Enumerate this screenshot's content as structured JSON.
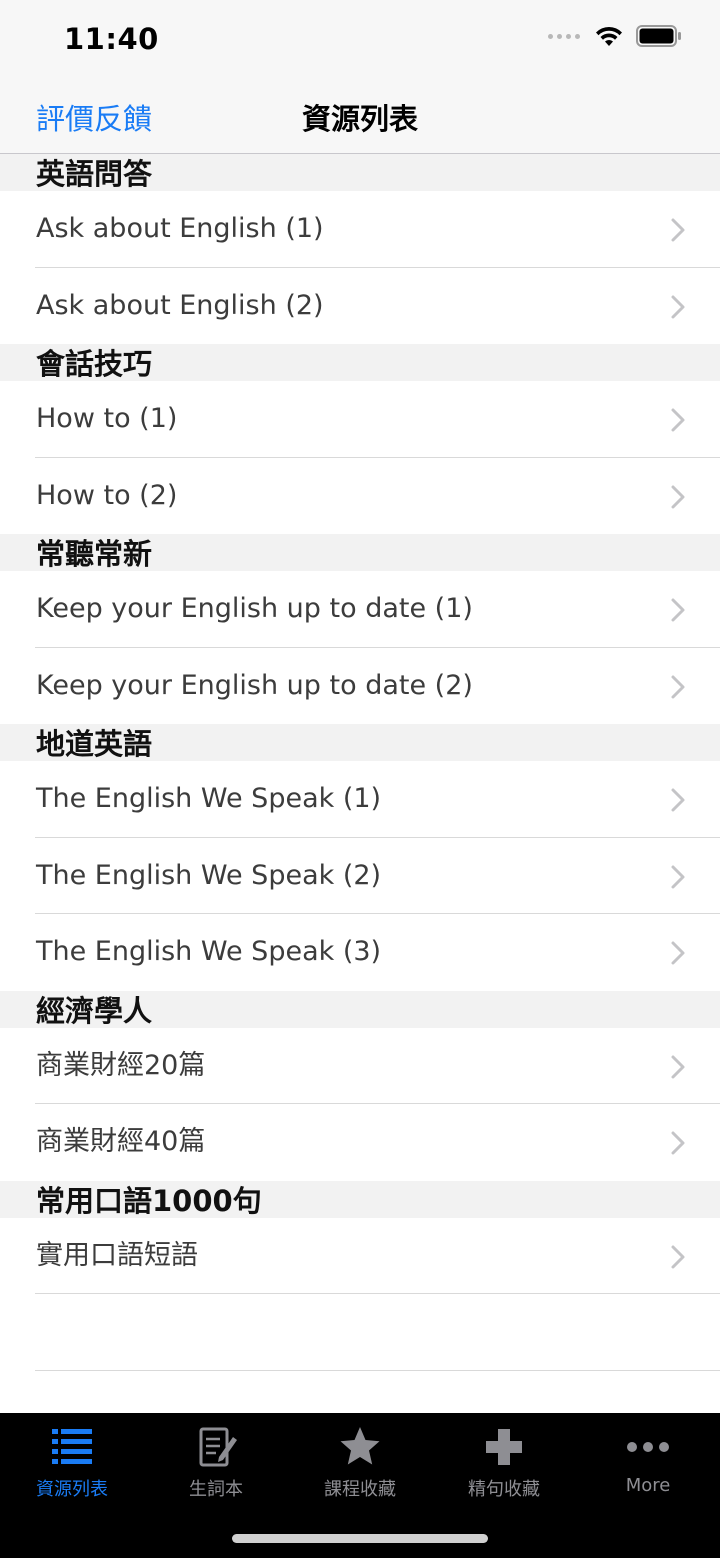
{
  "status_bar": {
    "time": "11:40"
  },
  "nav": {
    "left_button": "評價反饋",
    "title": "資源列表"
  },
  "sections": [
    {
      "header": "英語問答",
      "items": [
        "Ask about English (1)",
        "Ask about English (2)"
      ]
    },
    {
      "header": "會話技巧",
      "items": [
        "How to (1)",
        "How to (2)"
      ]
    },
    {
      "header": "常聽常新",
      "items": [
        "Keep your English up to date (1)",
        "Keep your English up to date (2)"
      ]
    },
    {
      "header": "地道英語",
      "items": [
        "The English We Speak (1)",
        "The English We Speak (2)",
        "The English We Speak (3)"
      ]
    },
    {
      "header": "經濟學人",
      "items": [
        "商業財經20篇",
        "商業財經40篇"
      ]
    },
    {
      "header": "常用口語1000句",
      "items": [
        "實用口語短語"
      ]
    }
  ],
  "tabbar": {
    "tabs": [
      {
        "label": "資源列表",
        "icon": "list-icon",
        "active": true
      },
      {
        "label": "生詞本",
        "icon": "notebook-edit-icon",
        "active": false
      },
      {
        "label": "課程收藏",
        "icon": "star-icon",
        "active": false
      },
      {
        "label": "精句收藏",
        "icon": "plus-icon",
        "active": false
      },
      {
        "label": "More",
        "icon": "more-dots-icon",
        "active": false
      }
    ]
  },
  "colors": {
    "accent": "#1a7cf5",
    "inactive": "#8e8e93",
    "tabbar_bg": "#000000"
  }
}
